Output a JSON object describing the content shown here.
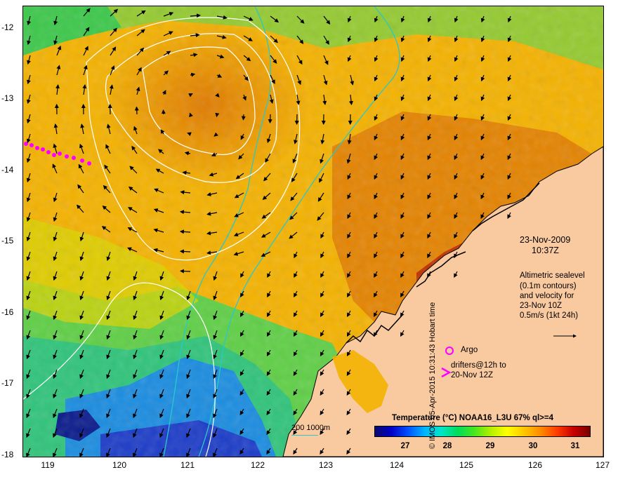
{
  "map": {
    "y_axis_labels": [
      "-12",
      "-13",
      "-14",
      "-15",
      "-16",
      "-17",
      "-18"
    ],
    "x_axis_labels": [
      "119",
      "120",
      "121",
      "122",
      "123",
      "124",
      "125",
      "126",
      "127"
    ],
    "lon_range": [
      118.6,
      127.0
    ],
    "lat_range": [
      -18.0,
      -11.7
    ]
  },
  "annotations": {
    "date": "23-Nov-2009",
    "time": "10:37Z",
    "legend_line1": "Altimetric sealevel",
    "legend_line2": "(0.1m contours)",
    "legend_line3": "and velocity for",
    "legend_line4": "23-Nov 10Z",
    "legend_line5": "0.5m/s (1kt 24h)",
    "argo_label": "Argo",
    "drifters_line1": "drifters@12h to",
    "drifters_line2": "20-Nov 12Z",
    "contour_key": "200  1000m",
    "credit": "© IMOS 05-Apr-2015 10:31:43 Hobart time"
  },
  "colorbar": {
    "title": "Temperature (°C) NOAA16_L3U 67% ql>=4",
    "ticks": [
      "27",
      "28",
      "29",
      "30",
      "31"
    ]
  },
  "colors": {
    "land": "#f9c9a0",
    "argo": "#ff00ff",
    "drifter": "#ff00ff",
    "isobath": "#2ac8c8",
    "sealevel_contour": "#ffffff"
  }
}
